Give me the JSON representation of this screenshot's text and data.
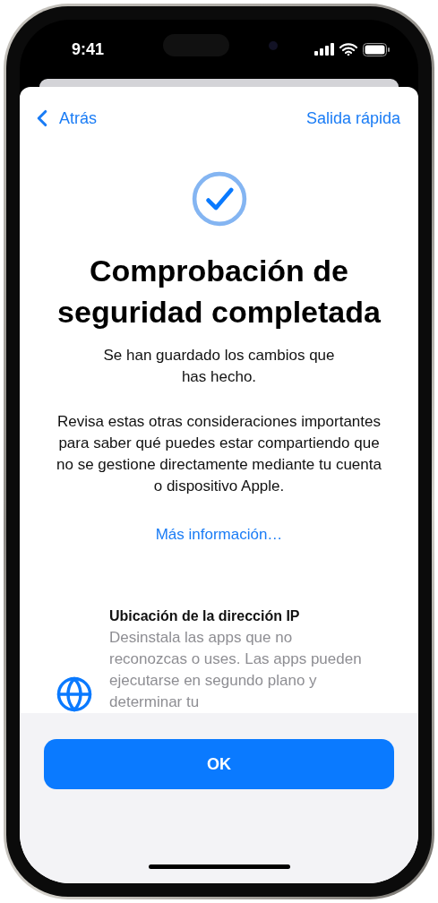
{
  "status_bar": {
    "time": "9:41"
  },
  "nav": {
    "back": "Atrás",
    "quick_exit": "Salida rápida"
  },
  "title": "Comprobación de seguridad completada",
  "subtitle": "Se han guardado los cambios que has hecho.",
  "body": "Revisa estas otras consideraciones importantes para saber qué puedes estar compartiendo que no se gestione directamente mediante tu cuenta o dispositivo Apple.",
  "link": "Más información…",
  "items": [
    {
      "title": "Ubicación de la dirección IP",
      "description": "Desinstala las apps que no reconozcas o uses. Las apps pueden ejecutarse en segundo plano y determinar tu"
    }
  ],
  "button": "OK"
}
